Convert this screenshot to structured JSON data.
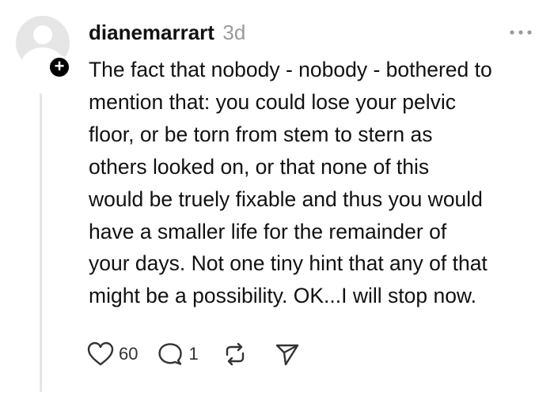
{
  "post": {
    "username": "dianemarrart",
    "timestamp": "3d",
    "text": "The fact that nobody - nobody - bothered to\nmention that: you could lose your pelvic\nfloor, or be torn from stem to stern as\nothers looked on, or that none of this\nwould be truely fixable and thus you would\nhave a smaller life for the remainder of\nyour days. Not one tiny hint that any of that\nmight be a possibility. OK...I will stop now.",
    "follow_badge": "+",
    "actions": {
      "likes": "60",
      "replies": "1"
    }
  },
  "icons": {
    "avatar": "default-avatar-icon",
    "follow": "plus-icon",
    "more": "more-horizontal-icon",
    "like": "heart-icon",
    "reply": "comment-bubble-icon",
    "repost": "repost-icon",
    "share": "send-icon"
  },
  "colors": {
    "text": "#111111",
    "muted": "#9a9a9a",
    "avatar_bg": "#e6e6e6",
    "thread_line": "#e4e4e4"
  }
}
